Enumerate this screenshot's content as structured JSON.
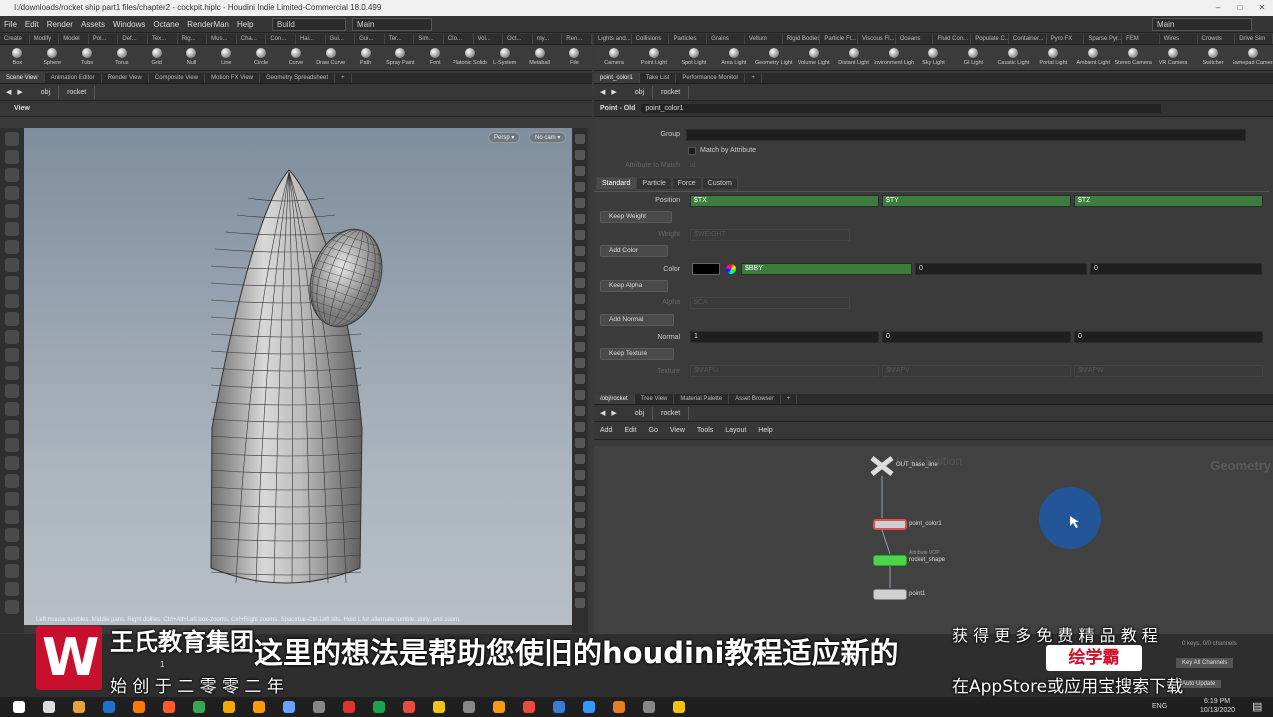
{
  "title": {
    "text": "I:/downloads/rocket ship part1 files/chapter2 - cockpit.hiplc - Houdini Indie Limited-Commercial 18.0.499"
  },
  "menu": {
    "items": [
      "File",
      "Edit",
      "Render",
      "Assets",
      "Windows",
      "Octane",
      "RenderMan",
      "Help"
    ],
    "desktop": "Build",
    "main": "Main",
    "main_right": "Main"
  },
  "shelf_left": {
    "tabs": [
      "Create",
      "Modify",
      "Model",
      "Pol...",
      "Def...",
      "Tex...",
      "Rig...",
      "Mus...",
      "Cha...",
      "Con...",
      "Hai...",
      "Gui...",
      "Gui...",
      "Ter...",
      "Sim...",
      "Clo...",
      "Vol...",
      "Oct...",
      "my...",
      "Ren..."
    ],
    "tools": [
      "Box",
      "Sphere",
      "Tubs",
      "Torus",
      "Grid",
      "Null",
      "Line",
      "Circle",
      "Curve",
      "Draw Curve",
      "Path",
      "Spray Paint",
      "Font",
      "Platonic Solids",
      "L-System",
      "Metaball",
      "File"
    ]
  },
  "shelf_right": {
    "tabs": [
      "Lights and...",
      "Collisions",
      "Particles",
      "Grains",
      "Vellum",
      "Rigid Bodies",
      "Particle Fl...",
      "Viscous Fl...",
      "Oceans",
      "Fluid Con...",
      "Populate C...",
      "Container...",
      "Pyro FX",
      "Sparse Pyr...",
      "FEM",
      "Wires",
      "Crowds",
      "Drive Sim"
    ],
    "tools": [
      "Camera",
      "Point Light",
      "Spot Light",
      "Area Light",
      "Geometry Light",
      "Volume Light",
      "Distant Light",
      "Environment Light",
      "Sky Light",
      "GI Light",
      "Caustic Light",
      "Portal Light",
      "Ambient Light",
      "Stereo Camera",
      "VR Camera",
      "Switcher",
      "Gamepad Camera"
    ]
  },
  "left_pane": {
    "tabs": [
      "Scene View",
      "Animation Editor",
      "Render View",
      "Composite View",
      "Motion FX View",
      "Geometry Spreadsheet"
    ],
    "path_root": "obj",
    "path_node": "rocket",
    "view_label": "View",
    "persp": "Persp ▾",
    "cam": "No cam ▾",
    "hint": "Left mouse tumbles. Middle pans. Right dollies. Ctrl+Alt+Left box-zooms. Ctrl+Right zooms. Spacebar-Ctrl-Left tilts. Hold L for alternate tumble, dolly, and zoom."
  },
  "params": {
    "tabs": [
      "point_color1",
      "Take List",
      "Performance Monitor"
    ],
    "path_root": "obj",
    "path_node": "rocket",
    "node_type": "Point - Old",
    "node_name": "point_color1",
    "group_label": "Group",
    "match_attr": "Match by Attribute",
    "attr_to_match": "Attribute to Match",
    "attr_value": "id",
    "sub_tabs": [
      "Standard",
      "Particle",
      "Force",
      "Custom"
    ],
    "position_label": "Position",
    "position": [
      "$TX",
      "$TY",
      "$TZ"
    ],
    "keep_weight": "Keep Weight",
    "weight_label": "Weight",
    "weight": "$WEIGHT",
    "add_color": "Add Color",
    "color_label": "Color",
    "color": [
      "$BBY",
      "0",
      "0"
    ],
    "keep_alpha": "Keep Alpha",
    "alpha_label": "Alpha",
    "alpha": "$CA",
    "add_normal": "Add Normal",
    "normal_label": "Normal",
    "normal": [
      "1",
      "0",
      "0"
    ],
    "keep_texture": "Keep Texture",
    "texture_label": "Texture",
    "texture": [
      "$MAPU",
      "$MAPV",
      "$MAPW"
    ]
  },
  "network": {
    "tabs": [
      "/obj/rocket",
      "Tree View",
      "Material Palette",
      "Asset Browser"
    ],
    "path_root": "obj",
    "path_node": "rocket",
    "menu": [
      "Add",
      "Edit",
      "Go",
      "View",
      "Tools",
      "Layout",
      "Help"
    ],
    "context": "Geometry",
    "watermark": "Indie Edition",
    "nodes": [
      {
        "name": "OUT_base_line"
      },
      {
        "name": "point_color1"
      },
      {
        "name": "rocket_shape",
        "sub": "Attribute VOP"
      },
      {
        "name": "point1"
      }
    ]
  },
  "playbar": {
    "frame": "1",
    "keys": "0 keys, 0/0 channels",
    "key_all": "Key All Channels",
    "auto_update": "Auto Update"
  },
  "subtitle": {
    "main": "这里的想法是帮助您使旧的houdini教程适应新的",
    "brand": "王氏教育集团",
    "since": "始 创 于 二 零 零 二 年",
    "free": "获 得 更 多 免 费 精 品 教 程",
    "app": "在AppStore或应用宝搜索下载",
    "logo": "绘学霸"
  },
  "taskbar": {
    "lang": "ENG",
    "time": "6:19 PM",
    "date": "10/13/2020"
  }
}
